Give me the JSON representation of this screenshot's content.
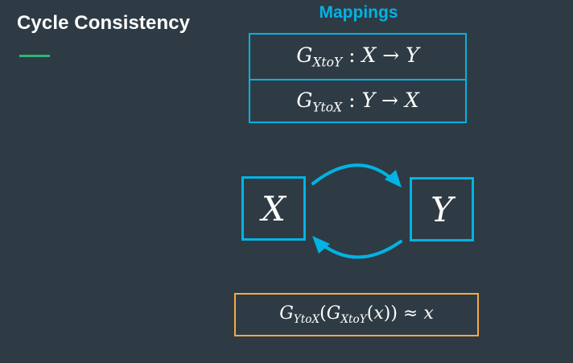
{
  "slide": {
    "title": "Cycle Consistency"
  },
  "mappings": {
    "heading": "Mappings",
    "rows": [
      {
        "G": "G",
        "sub": "XtoY",
        "colon": ":",
        "from": "X",
        "arrow": "→",
        "to": "Y"
      },
      {
        "G": "G",
        "sub": "YtoX",
        "colon": ":",
        "from": "Y",
        "arrow": "→",
        "to": "X"
      }
    ]
  },
  "cycle": {
    "node_left": "X",
    "node_right": "Y"
  },
  "identity": {
    "outer_G": "G",
    "outer_sub": "YtoX",
    "open1": "(",
    "inner_G": "G",
    "inner_sub": "XtoY",
    "open2": "(",
    "var": "x",
    "close": "))",
    "approx": "≈",
    "rhs": "x"
  },
  "colors": {
    "background": "#2e3b44",
    "accent_blue": "#02b3e4",
    "accent_orange": "#f7a943",
    "accent_green": "#2bb673",
    "text": "#ffffff"
  }
}
